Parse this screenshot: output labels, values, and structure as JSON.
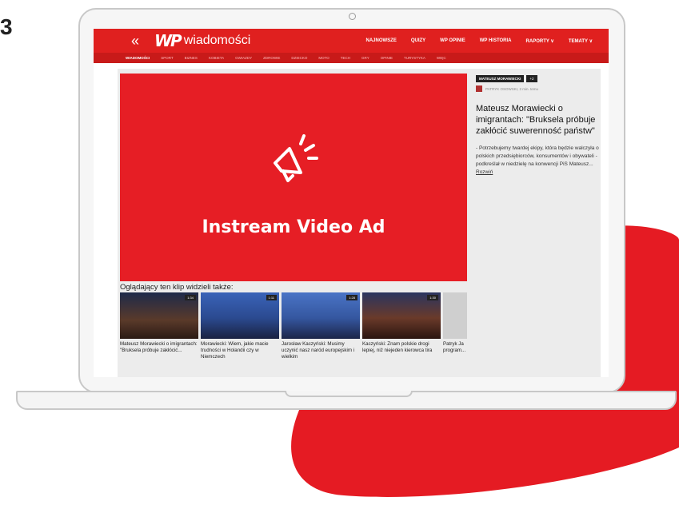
{
  "step": "3",
  "site": {
    "logo": "wiadomości",
    "nav": [
      "NAJNOWSZE",
      "QUIZY",
      "WP OPINIE",
      "WP HISTORIA",
      "RAPORTY ∨",
      "TEMATY ∨"
    ],
    "subnav": [
      "WIADOMOŚCI",
      "SPORT",
      "BIZNES",
      "KOBIETA",
      "GWIAZDY",
      "ZDROWIE",
      "DZIECKO",
      "MOTO",
      "TECH",
      "GRY",
      "OPINIE",
      "TURYSTYKA",
      "WIĘC"
    ]
  },
  "ad": {
    "label": "Instream Video Ad"
  },
  "sidebar": {
    "tag": "MATEUSZ MORAWIECKI",
    "tag_count": "+2",
    "author": "PATRYK OSOWSKI, 2 min. temu",
    "headline": "Mateusz Morawiecki o imigrantach: \"Bruksela próbuje zakłócić suwerenność państw\"",
    "lead": "- Potrzebujemy twardej ekipy, która będzie walczyła o polskich przedsiębiorców, konsumentów i obywateli - podkreślał w niedzielę na konwencji PiS Mateusz...",
    "expand": "Rozwiń"
  },
  "related": {
    "title": "Oglądający ten klip widzieli także:",
    "items": [
      {
        "duration": "1:34",
        "caption": "Mateusz Morawiecki o imigrantach: \"Bruksela próbuje zakłócić..."
      },
      {
        "duration": "1:11",
        "caption": "Morawiecki: Wiem, jakie macie trudności w Holandii czy w Niemczech"
      },
      {
        "duration": "1:28",
        "caption": "Jarosław Kaczyński: Musimy uczynić nasz naród europejskim i wielkim"
      },
      {
        "duration": "1:30",
        "caption": "Kaczyński: Znam polskie drogi lepiej, niż niejeden kierowca tira"
      },
      {
        "duration": "",
        "caption": "Patryk Ja program..."
      }
    ]
  },
  "colors": {
    "brand_red": "#e0201f",
    "ad_red": "#e61e25"
  }
}
